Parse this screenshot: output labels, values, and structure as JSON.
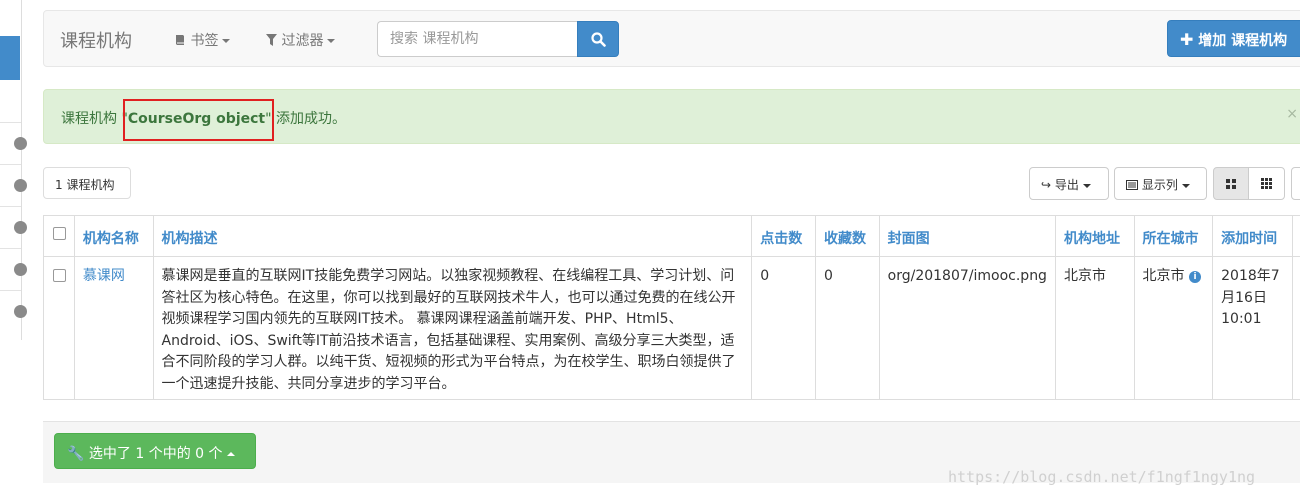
{
  "navbar": {
    "brand": "课程机构",
    "bookmarks_label": "书签",
    "filter_label": "过滤器",
    "search_placeholder": "搜索 课程机构",
    "add_label": "增加 课程机构"
  },
  "alert": {
    "prefix": "课程机构 \"",
    "object_name": "CourseOrg object",
    "suffix": "\" 添加成功。",
    "close": "×"
  },
  "toolbar": {
    "count": "1 课程机构",
    "export_label": "导出",
    "columns_label": "显示列"
  },
  "table": {
    "headers": [
      "机构名称",
      "机构描述",
      "点击数",
      "收藏数",
      "封面图",
      "机构地址",
      "所在城市",
      "添加时间"
    ],
    "rows": [
      {
        "name": "慕课网",
        "desc": "慕课网是垂直的互联网IT技能免费学习网站。以独家视频教程、在线编程工具、学习计划、问答社区为核心特色。在这里，你可以找到最好的互联网技术牛人，也可以通过免费的在线公开视频课程学习国内领先的互联网IT技术。 慕课网课程涵盖前端开发、PHP、Html5、Android、iOS、Swift等IT前沿技术语言，包括基础课程、实用案例、高级分享三大类型，适合不同阶段的学习人群。以纯干货、短视频的形式为平台特点，为在校学生、职场白领提供了一个迅速提升技能、共同分享进步的学习平台。",
        "clicks": "0",
        "favs": "0",
        "image": "org/201807/imooc.png",
        "address": "北京市",
        "city": "北京市",
        "added": "2018年7月16日 10:01"
      }
    ]
  },
  "footer": {
    "selection_label": "选中了 1 个中的 0 个"
  },
  "watermark": "https://blog.csdn.net/f1ngf1ngy1ng",
  "colors": {
    "primary": "#428bca",
    "success": "#5cb85c",
    "alert_bg": "#dff0d8",
    "highlight": "#e02020"
  }
}
